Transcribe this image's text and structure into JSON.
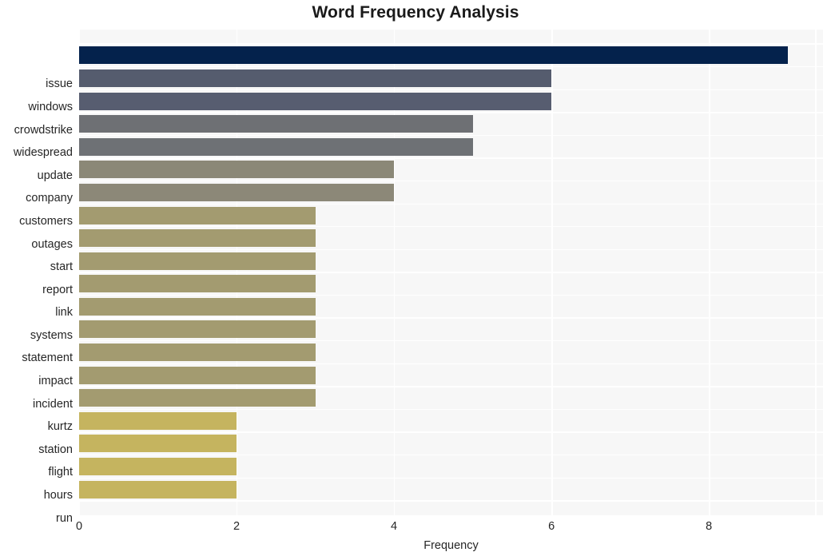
{
  "chart_data": {
    "type": "bar",
    "orientation": "horizontal",
    "title": "Word Frequency Analysis",
    "xlabel": "Frequency",
    "ylabel": "",
    "xlim": [
      0,
      9.45
    ],
    "xticks": [
      0,
      2,
      4,
      6,
      8
    ],
    "xtick_labels": [
      "0",
      "2",
      "4",
      "6",
      "8"
    ],
    "grid": true,
    "grid_color": "#ffffff",
    "plot_background": "#f7f7f7",
    "figure_background": "#ffffff",
    "legend": null,
    "categories": [
      "issue",
      "windows",
      "crowdstrike",
      "widespread",
      "update",
      "company",
      "customers",
      "outages",
      "start",
      "report",
      "link",
      "systems",
      "statement",
      "impact",
      "incident",
      "kurtz",
      "station",
      "flight",
      "hours",
      "run"
    ],
    "values": [
      9,
      6,
      6,
      5,
      5,
      4,
      4,
      3,
      3,
      3,
      3,
      3,
      3,
      3,
      3,
      3,
      2,
      2,
      2,
      2
    ],
    "bar_colors": [
      "#04224c",
      "#555c6e",
      "#575d70",
      "#6e7074",
      "#6e7175",
      "#8b8877",
      "#8c8878",
      "#a39b70",
      "#a39b70",
      "#a39b70",
      "#a39b70",
      "#a39b70",
      "#a39b70",
      "#a39b70",
      "#a39b70",
      "#a39b70",
      "#c5b45f",
      "#c5b45f",
      "#c5b45f",
      "#c5b45f"
    ]
  }
}
